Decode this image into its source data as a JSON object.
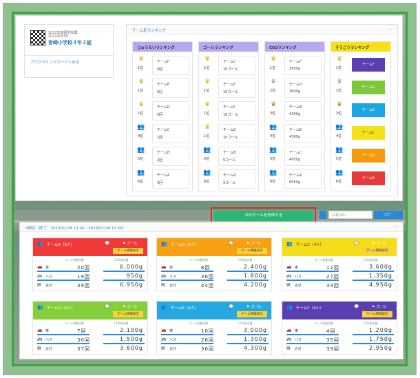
{
  "school": {
    "subtitle1": "2022年度研究授業",
    "subtitle2": "2022/02/00",
    "name": "宮崎小学校４年３組",
    "link": "プログラミングボードへ戻る"
  },
  "ranking": {
    "header": "チーム別ランキング",
    "columns": [
      {
        "title": "じゅうたいランキング",
        "head_color": "#b9a8f0",
        "rows": [
          {
            "icon": "crown-gold-icon",
            "glyph": "♛",
            "glyph_color": "#e0a800",
            "rank": "1位",
            "team": "チームF",
            "value": "0回"
          },
          {
            "icon": "crown-gold-icon",
            "glyph": "♛",
            "glyph_color": "#e0a800",
            "rank": "1位",
            "team": "チームE",
            "value": "0回"
          },
          {
            "icon": "crown-gold-icon",
            "glyph": "♛",
            "glyph_color": "#e0a800",
            "rank": "1位",
            "team": "チームD",
            "value": "0回"
          },
          {
            "icon": "people-icon",
            "glyph": "👥",
            "glyph_color": "#444",
            "rank": "4位",
            "team": "チームC",
            "value": "1回"
          },
          {
            "icon": "people-icon",
            "glyph": "👥",
            "glyph_color": "#444",
            "rank": "5位",
            "team": "チームB",
            "value": "2回"
          },
          {
            "icon": "people-icon",
            "glyph": "👥",
            "glyph_color": "#444",
            "rank": "6位",
            "team": "チームA",
            "value": "3回"
          }
        ]
      },
      {
        "title": "ゴールランキング",
        "head_color": "#b9a8f0",
        "rows": [
          {
            "icon": "crown-gold-icon",
            "glyph": "♛",
            "glyph_color": "#e0a800",
            "rank": "1位",
            "team": "チームC",
            "value": "10ゴール"
          },
          {
            "icon": "crown-gold-icon",
            "glyph": "♛",
            "glyph_color": "#e0a800",
            "rank": "1位",
            "team": "チームE",
            "value": "10ゴール"
          },
          {
            "icon": "crown-gold-icon",
            "glyph": "♛",
            "glyph_color": "#e0a800",
            "rank": "1位",
            "team": "チームF",
            "value": "10ゴール"
          },
          {
            "icon": "crown-gold-icon",
            "glyph": "♛",
            "glyph_color": "#e0a800",
            "rank": "1位",
            "team": "チームD",
            "value": "10ゴール"
          },
          {
            "icon": "people-icon",
            "glyph": "👥",
            "glyph_color": "#444",
            "rank": "5位",
            "team": "チームB",
            "value": "9ゴール"
          },
          {
            "icon": "people-icon",
            "glyph": "👥",
            "glyph_color": "#444",
            "rank": "6位",
            "team": "チームA",
            "value": "9ゴール"
          }
        ]
      },
      {
        "title": "CO2ランキング",
        "head_color": "#b9a8f0",
        "rows": [
          {
            "icon": "crown-gold-icon",
            "glyph": "♛",
            "glyph_color": "#e0a800",
            "rank": "1位",
            "team": "チームF",
            "value": "2950g"
          },
          {
            "icon": "crown-silver-icon",
            "glyph": "♛",
            "glyph_color": "#9a9a9a",
            "rank": "2位",
            "team": "チームD",
            "value": "3600g"
          },
          {
            "icon": "crown-bronze-icon",
            "glyph": "♛",
            "glyph_color": "#c07a2a",
            "rank": "3位",
            "team": "チームB",
            "value": "4200g"
          },
          {
            "icon": "people-icon",
            "glyph": "👥",
            "glyph_color": "#444",
            "rank": "4位",
            "team": "チームE",
            "value": "4300g"
          },
          {
            "icon": "people-icon",
            "glyph": "👥",
            "glyph_color": "#444",
            "rank": "5位",
            "team": "チームC",
            "value": "4950g"
          },
          {
            "icon": "people-icon",
            "glyph": "👥",
            "glyph_color": "#444",
            "rank": "6位",
            "team": "チームA",
            "value": "6950g"
          }
        ]
      },
      {
        "title": "そうごうランキング",
        "head_color": "#f5e11a",
        "rows": [
          {
            "icon": "crown-gold-icon",
            "glyph": "♛",
            "glyph_color": "#e0a800",
            "rank": "1位",
            "team": "チームF",
            "box_color": "#5a3fb0"
          },
          {
            "icon": "crown-silver-icon",
            "glyph": "♛",
            "glyph_color": "#9a9a9a",
            "rank": "2位",
            "team": "チームD",
            "box_color": "#7cc83a"
          },
          {
            "icon": "crown-bronze-icon",
            "glyph": "♛",
            "glyph_color": "#c07a2a",
            "rank": "3位",
            "team": "チームE",
            "box_color": "#1aa6e0"
          },
          {
            "icon": "people-icon",
            "glyph": "👥",
            "glyph_color": "#444",
            "rank": "4位",
            "team": "チームC",
            "box_color": "#f5e11a"
          },
          {
            "icon": "people-icon",
            "glyph": "👥",
            "glyph_color": "#444",
            "rank": "5位",
            "team": "チームB",
            "box_color": "#f59a0a"
          },
          {
            "icon": "people-icon",
            "glyph": "👥",
            "glyph_color": "#444",
            "rank": "6位",
            "team": "チームA",
            "box_color": "#e83a3a"
          }
        ]
      }
    ]
  },
  "toolbar": {
    "start_label": "次のゲームを作成する",
    "url_placeholder": "共有URL",
    "copy_label": "コピー"
  },
  "game": {
    "header": "4回目（終了：2023/01/18 11:45 - 2023/01/18 11:50）",
    "col1": "ゴール到着回数",
    "col2": "CO2排出量",
    "team_button": "ゲーム情報表示",
    "goal_label": "ゴール",
    "teams": [
      {
        "name": "チームA（6人）",
        "color": "#f03a3a",
        "rows": [
          {
            "icon": "car-icon",
            "glyph": "🚗",
            "label": "車",
            "count": "20回",
            "amount": "6,000g"
          },
          {
            "icon": "bus-icon",
            "glyph": "🚌",
            "label": "バス",
            "count": "19回",
            "amount": "950g"
          },
          {
            "icon": "total-icon",
            "glyph": "▤",
            "label": "合計",
            "count": "39回",
            "amount": "6,950g"
          }
        ]
      },
      {
        "name": "チームB（4人）",
        "color": "#f7a012",
        "rows": [
          {
            "icon": "car-icon",
            "glyph": "🚗",
            "label": "車",
            "count": "8回",
            "amount": "2,400g"
          },
          {
            "icon": "bus-icon",
            "glyph": "🚌",
            "label": "バス",
            "count": "36回",
            "amount": "1,800g"
          },
          {
            "icon": "total-icon",
            "glyph": "▤",
            "label": "合計",
            "count": "44回",
            "amount": "4,200g"
          }
        ]
      },
      {
        "name": "チームC（4人）",
        "color": "#f5dd1a",
        "rows": [
          {
            "icon": "car-icon",
            "glyph": "🚗",
            "label": "車",
            "count": "12回",
            "amount": "3,600g"
          },
          {
            "icon": "bus-icon",
            "glyph": "🚌",
            "label": "バス",
            "count": "27回",
            "amount": "1,350g"
          },
          {
            "icon": "total-icon",
            "glyph": "▤",
            "label": "合計",
            "count": "39回",
            "amount": "4,950g"
          }
        ]
      },
      {
        "name": "チームD（4人）",
        "color": "#84cf3a",
        "rows": [
          {
            "icon": "car-icon",
            "glyph": "🚗",
            "label": "車",
            "count": "7回",
            "amount": "2,100g"
          },
          {
            "icon": "bus-icon",
            "glyph": "🚌",
            "label": "バス",
            "count": "30回",
            "amount": "1,500g"
          },
          {
            "icon": "total-icon",
            "glyph": "▤",
            "label": "合計",
            "count": "37回",
            "amount": "3,600g"
          }
        ]
      },
      {
        "name": "チームE（4人）",
        "color": "#26a9e0",
        "rows": [
          {
            "icon": "car-icon",
            "glyph": "🚗",
            "label": "車",
            "count": "10回",
            "amount": "3,000g"
          },
          {
            "icon": "bus-icon",
            "glyph": "🚌",
            "label": "バス",
            "count": "26回",
            "amount": "1,300g"
          },
          {
            "icon": "total-icon",
            "glyph": "▤",
            "label": "合計",
            "count": "36回",
            "amount": "4,300g"
          }
        ]
      },
      {
        "name": "チームF（4人）",
        "color": "#5a3fb0",
        "rows": [
          {
            "icon": "car-icon",
            "glyph": "🚗",
            "label": "車",
            "count": "4回",
            "amount": "1,200g"
          },
          {
            "icon": "bus-icon",
            "glyph": "🚌",
            "label": "バス",
            "count": "35回",
            "amount": "1,750g"
          },
          {
            "icon": "total-icon",
            "glyph": "▤",
            "label": "合計",
            "count": "39回",
            "amount": "2,950g"
          }
        ]
      }
    ]
  }
}
